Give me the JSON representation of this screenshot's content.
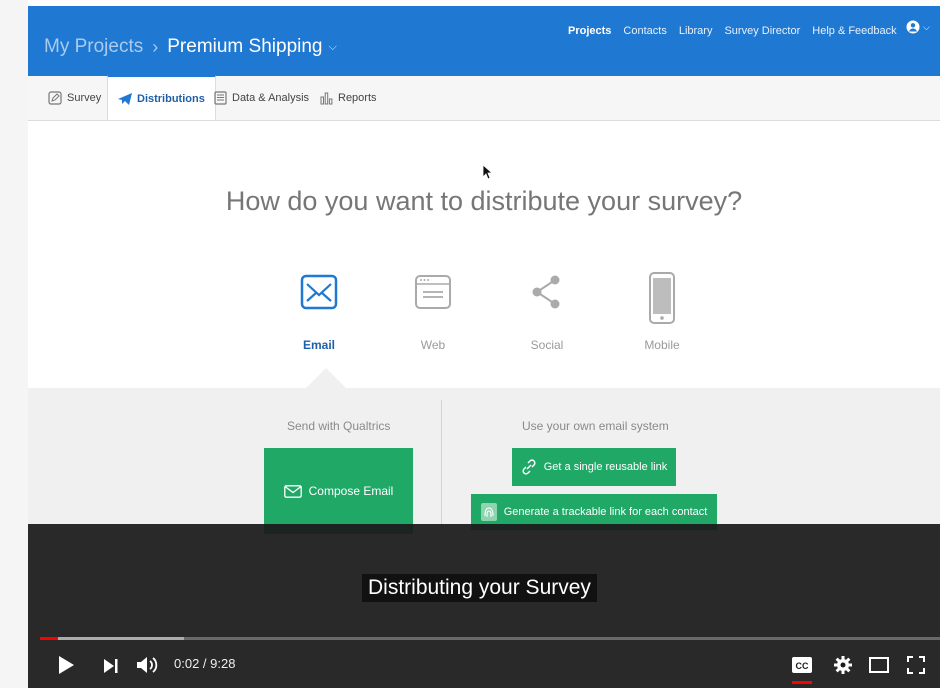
{
  "topbar": {
    "breadcrumb_root": "My Projects",
    "breadcrumb_sep": "›",
    "project_name": "Premium Shipping",
    "nav": [
      "Projects",
      "Contacts",
      "Library",
      "Survey Director",
      "Help & Feedback"
    ],
    "active_nav": "Projects"
  },
  "tabs": {
    "survey": "Survey",
    "distributions": "Distributions",
    "data_analysis": "Data & Analysis",
    "reports": "Reports"
  },
  "main": {
    "headline": "How do you want to distribute your survey?",
    "options": {
      "email": "Email",
      "web": "Web",
      "social": "Social",
      "mobile": "Mobile"
    }
  },
  "panel": {
    "left_title": "Send with Qualtrics",
    "compose_email": "Compose Email",
    "right_title": "Use your own email system",
    "single_link": "Get a single reusable link",
    "trackable_link": "Generate a trackable link for each contact"
  },
  "video": {
    "caption": "Distributing your Survey",
    "time": "0:02 / 9:28",
    "progress_played": 0.02,
    "progress_loaded": 0.16
  },
  "colors": {
    "brand_blue": "#1f78d1",
    "green": "#1fa866",
    "progress_red": "#ff0000"
  }
}
